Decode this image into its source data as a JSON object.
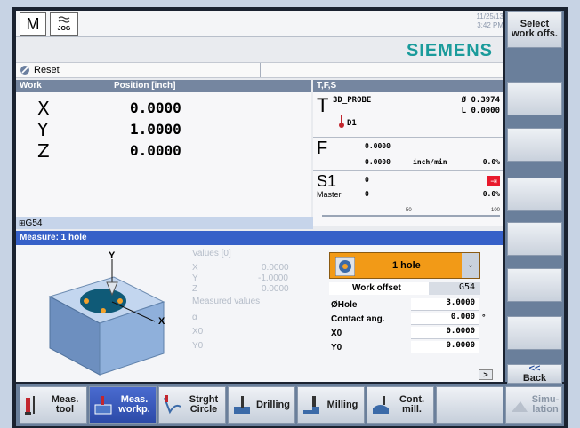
{
  "header": {
    "clock_date": "11/25/13",
    "clock_time": "3:42 PM",
    "brand": "SIEMENS",
    "status": "Reset",
    "mode_icon": "M",
    "jog_label": "JOG"
  },
  "position": {
    "col_work": "Work",
    "col_pos": "Position [inch]",
    "rows": [
      {
        "axis": "X",
        "value": "0.0000"
      },
      {
        "axis": "Y",
        "value": "1.0000"
      },
      {
        "axis": "Z",
        "value": "0.0000"
      }
    ]
  },
  "tool": {
    "header": "T,F,S",
    "t_label": "T",
    "name": "3D_PROBE",
    "d_label": "D1",
    "dia": "Ø 0.3974",
    "len": "L 0.0000",
    "f_label": "F",
    "f_val1": "0.0000",
    "f_val2": "0.0000",
    "f_unit": "inch/min",
    "f_pct": "0.0%",
    "s_label": "S1",
    "s_val": "0",
    "s_master": "Master",
    "s_master_val": "0",
    "s_pct": "0.0%",
    "s_scale_50": "50",
    "s_scale_100": "100"
  },
  "work_offset_active": "G54",
  "measure": {
    "title": "Measure: 1 hole",
    "diagram_y": "Y",
    "diagram_x": "X",
    "grey_values": {
      "title": "Values [0]",
      "x": "X",
      "x_val": "0.0000",
      "y": "Y",
      "y_val": "-1.0000",
      "z": "Z",
      "z_val": "0.0000",
      "measured": "Measured values",
      "x0": "X0",
      "y0": "Y0",
      "alpha": "α"
    },
    "mode_select": "1 hole",
    "fields": [
      {
        "label": "Work offset",
        "value": "G54"
      },
      {
        "label": "ØHole",
        "value": "3.0000"
      },
      {
        "label": "Contact ang.",
        "value": "0.000",
        "unit": "°"
      },
      {
        "label": "X0",
        "value": "0.0000"
      },
      {
        "label": "Y0",
        "value": "0.0000"
      }
    ]
  },
  "vsoftkeys": {
    "select_work": "Select work offs.",
    "back": "Back",
    "back_icon": "<<"
  },
  "hsoftkeys": [
    {
      "label": "Meas. tool",
      "icon": "meas-tool-icon"
    },
    {
      "label": "Meas. workp.",
      "icon": "meas-workpiece-icon"
    },
    {
      "label": "Strght Circle",
      "icon": "straight-circle-icon"
    },
    {
      "label": "Drilling",
      "icon": "drilling-icon"
    },
    {
      "label": "Milling",
      "icon": "milling-icon"
    },
    {
      "label": "Cont. mill.",
      "icon": "contour-mill-icon"
    },
    {
      "label": "Simu- lation",
      "icon": "simulation-icon"
    }
  ],
  "more_indicator": ">",
  "colors": {
    "brand": "#1a9b9b",
    "active_blue": "#3660c8",
    "select_orange": "#f29a17",
    "red_indicator": "#e8192c"
  }
}
